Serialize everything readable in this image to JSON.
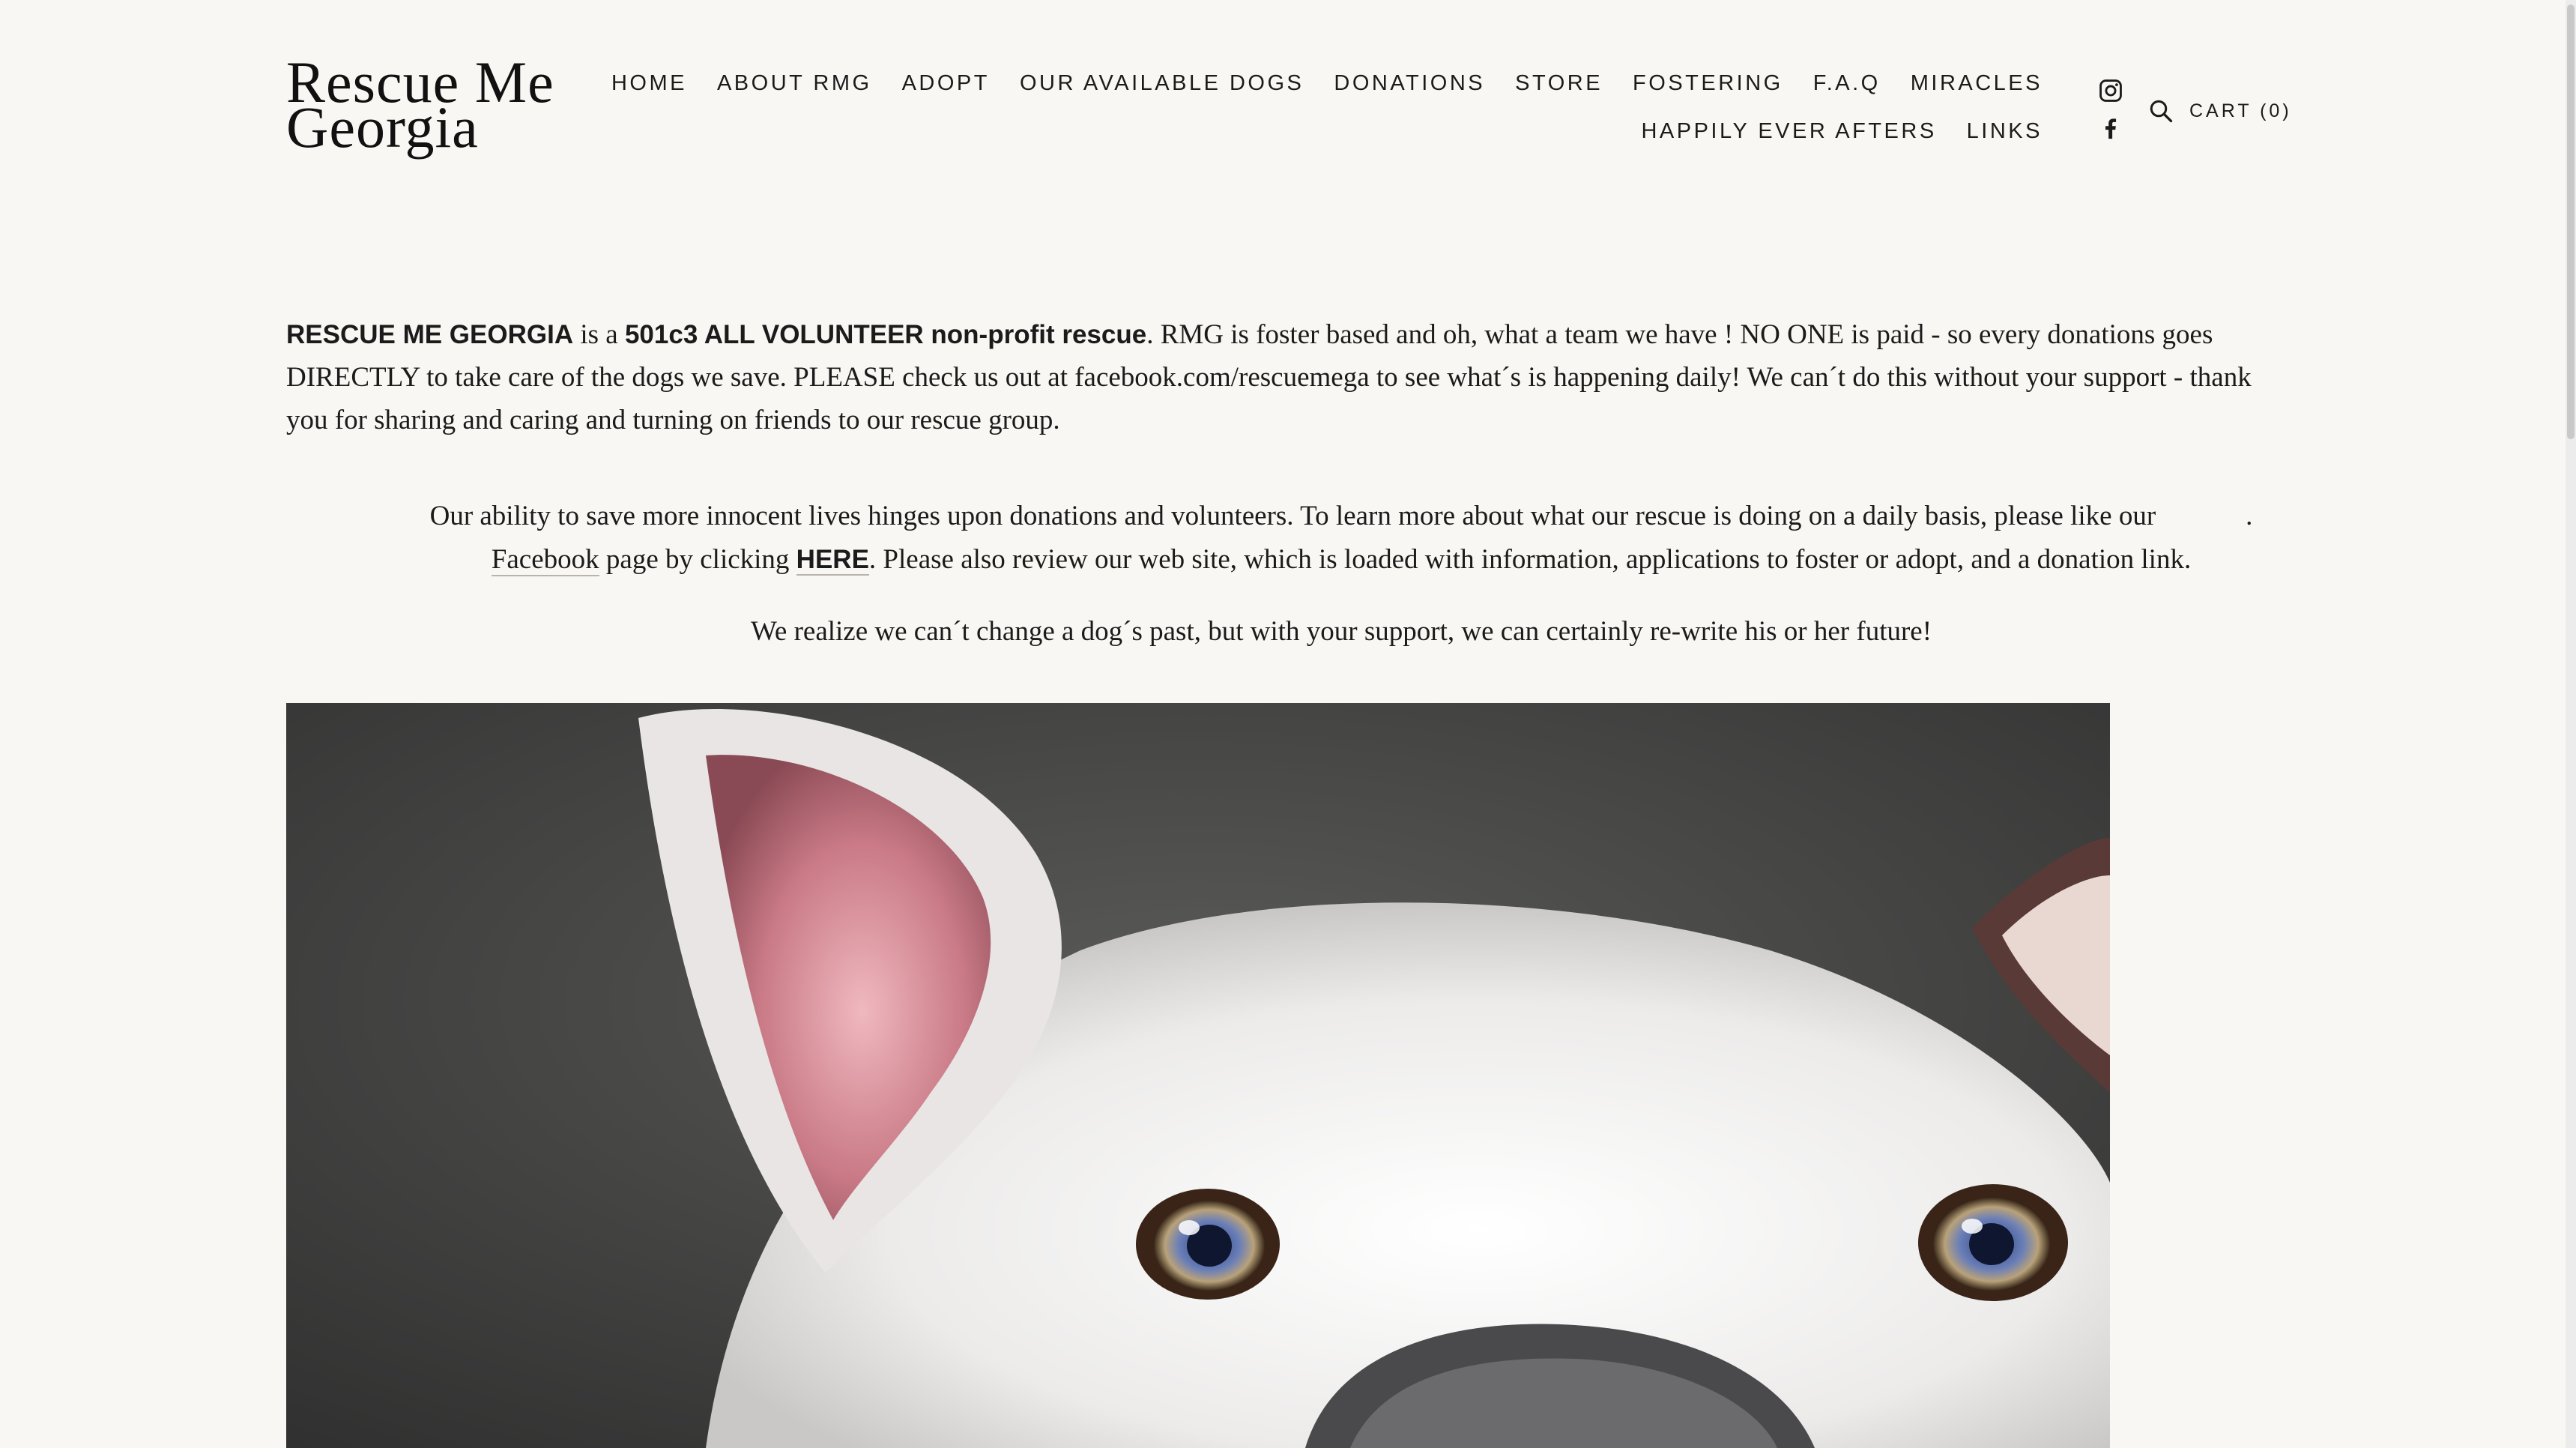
{
  "site": {
    "title_line1": "Rescue Me",
    "title_line2": "Georgia"
  },
  "nav": {
    "row1": [
      "HOME",
      "ABOUT RMG",
      "ADOPT",
      "OUR AVAILABLE DOGS",
      "DONATIONS",
      "STORE",
      "FOSTERING",
      "F.A.Q",
      "MIRACLES"
    ],
    "row2": [
      "HAPPILY EVER AFTERS",
      "LINKS"
    ]
  },
  "header_actions": {
    "social_icons": [
      "instagram-icon",
      "facebook-icon"
    ],
    "search_icon": "search-icon",
    "cart_label": "CART (0)"
  },
  "intro": {
    "org_name": "RESCUE ME GEORGIA",
    "is_a": " is a ",
    "org_type": "501c3 ALL VOLUNTEER non-profit rescue",
    "text": ". RMG is foster based and oh, what a team we have ! NO ONE is paid - so every donations goes DIRECTLY to take care of the dogs we save.  PLEASE check us out at facebook.com/rescuemega to see what´s is happening daily!  We can´t do this without your support - thank you for sharing and caring and turning on friends to our rescue group."
  },
  "ability": {
    "line1": "Our ability to save more innocent lives hinges upon donations and volunteers. To learn more about what our rescue is doing on a daily basis, please like our",
    "line1_end": ".",
    "facebook_link": "Facebook",
    "page_by_clicking": " page by clicking ",
    "here_link": "HERE",
    "line2_rest": ". Please also review our web site, which is loaded with information, applications to foster or adopt, and a donation link."
  },
  "realize": {
    "text": "We realize we can´t change a dog´s past, but with your support, we can certainly re-write his or her future!"
  },
  "hero": {
    "image_label": "white-dog-photo"
  },
  "colors": {
    "background": "#f9f7f3",
    "text": "#1b1b1b",
    "link_underline": "#b9b4ab"
  }
}
